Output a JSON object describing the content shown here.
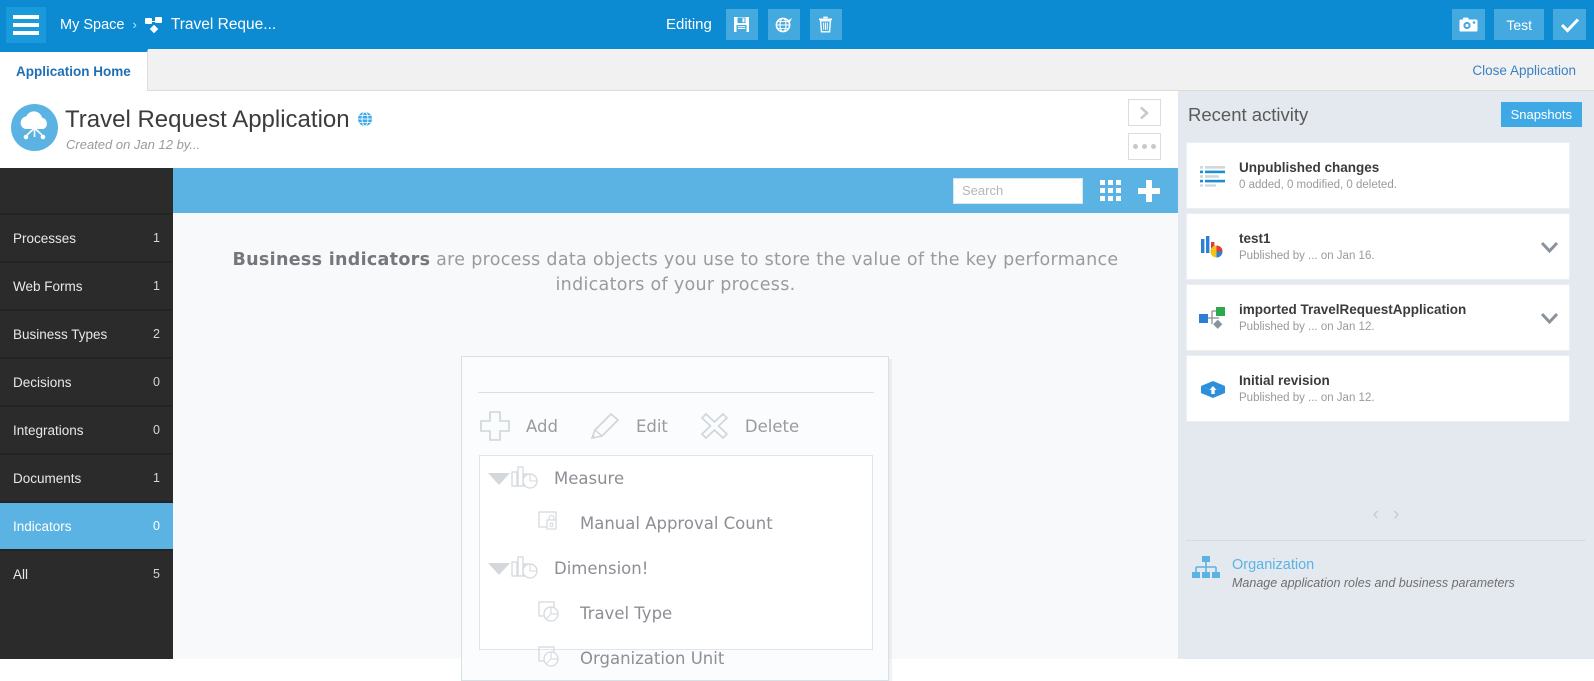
{
  "topbar": {
    "menu_icon": "hamburger-icon",
    "breadcrumb_root": "My Space",
    "breadcrumb_sep": "›",
    "breadcrumb_current": "Travel Reque...",
    "editing_label": "Editing",
    "save_icon": "floppy-disk-icon",
    "publish_icon": "globe-publish-icon",
    "delete_icon": "trash-icon",
    "camera_icon": "camera-icon",
    "test_label": "Test",
    "confirm_icon": "check-icon",
    "accent": "#0c8ad2",
    "button_bg": "#44a9de"
  },
  "tabs": {
    "active_tab": "Application Home",
    "close_application": "Close Application"
  },
  "app": {
    "icon": "cloud-network-icon",
    "title": "Travel Request Application",
    "title_badge_icon": "globe-icon",
    "subtitle": "Created on Jan 12 by...",
    "expand_icon": "chevron-right-icon",
    "more_icon": "more-dots-icon"
  },
  "sidebar": {
    "items": [
      {
        "label": "Processes",
        "count": "1",
        "active": false
      },
      {
        "label": "Web Forms",
        "count": "1",
        "active": false
      },
      {
        "label": "Business Types",
        "count": "2",
        "active": false
      },
      {
        "label": "Decisions",
        "count": "0",
        "active": false
      },
      {
        "label": "Integrations",
        "count": "0",
        "active": false
      },
      {
        "label": "Documents",
        "count": "1",
        "active": false
      },
      {
        "label": "Indicators",
        "count": "0",
        "active": true
      },
      {
        "label": "All",
        "count": "5",
        "active": false
      }
    ],
    "active_color": "#5bb3e4",
    "bg": "#2b2b2b"
  },
  "content": {
    "search_placeholder": "Search",
    "search_value": "",
    "grid_icon": "grid-view-icon",
    "add_icon": "plus-icon",
    "hint_bold": "Business indicators",
    "hint_rest": " are process data objects you use to store the value of the key performance indicators of your process.",
    "panel": {
      "add_label": "Add",
      "edit_label": "Edit",
      "delete_label": "Delete",
      "add_icon": "plus-sketch-icon",
      "edit_icon": "pencil-sketch-icon",
      "delete_icon": "x-sketch-icon",
      "tree": [
        {
          "label": "Measure",
          "level": 0,
          "expanded": true,
          "icon": "chart-icon"
        },
        {
          "label": "Manual Approval Count",
          "level": 1,
          "expanded": false,
          "icon": "locked-doc-icon"
        },
        {
          "label": "Dimension!",
          "level": 0,
          "expanded": true,
          "icon": "chart-icon"
        },
        {
          "label": "Travel Type",
          "level": 1,
          "expanded": false,
          "icon": "pie-doc-icon"
        },
        {
          "label": "Organization Unit",
          "level": 1,
          "expanded": false,
          "icon": "pie-doc-icon"
        }
      ]
    }
  },
  "recent_activity": {
    "title": "Recent activity",
    "snapshots_label": "Snapshots",
    "items": [
      {
        "icon": "changes-list-icon",
        "title": "Unpublished changes",
        "subtitle": "0 added, 0 modified, 0 deleted.",
        "has_chevron": false
      },
      {
        "icon": "barchart-pie-icon",
        "title": "test1",
        "subtitle": "Published by ...   on Jan 16.",
        "has_chevron": true
      },
      {
        "icon": "process-nodes-icon",
        "title": "imported TravelRequestApplication",
        "subtitle": "Published by ...   on Jan 12.",
        "has_chevron": true
      },
      {
        "icon": "open-box-icon",
        "title": "Initial revision",
        "subtitle": "Published by ...   on Jan 12.",
        "has_chevron": false
      }
    ],
    "pager_prev": "‹",
    "pager_next": "›",
    "organization_icon": "org-chart-icon",
    "organization_link": "Organization",
    "organization_sub": "Manage application roles and business parameters"
  }
}
